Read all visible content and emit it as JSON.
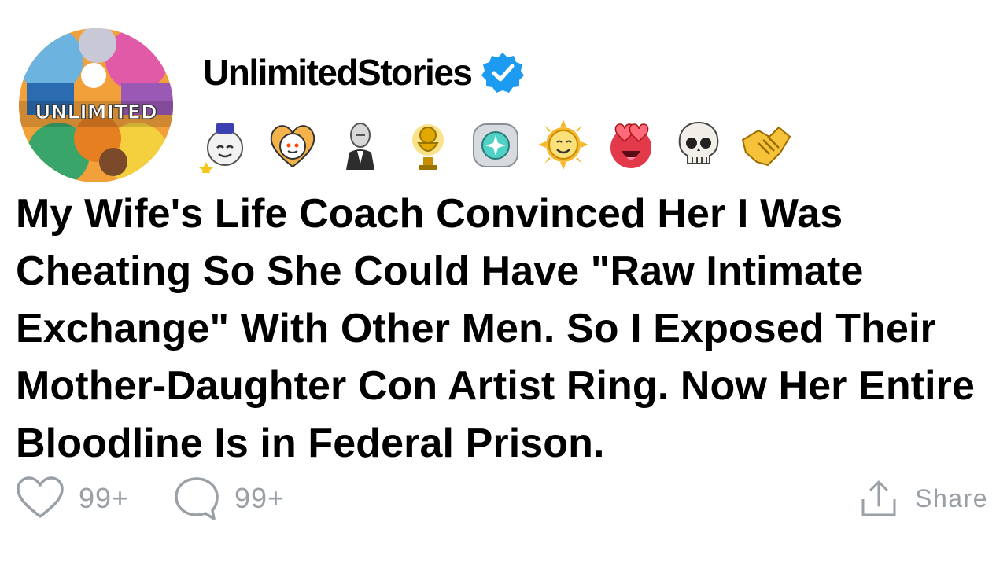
{
  "author": {
    "name": "UnlimitedStories",
    "avatar_text": "UNLIMITED",
    "verified_icon": "verified-check-icon"
  },
  "awards": [
    {
      "icon": "wholesome-award-icon"
    },
    {
      "icon": "heart-eyes-award-icon"
    },
    {
      "icon": "meme-guy-award-icon"
    },
    {
      "icon": "gold-trophy-award-icon"
    },
    {
      "icon": "platinum-gem-award-icon"
    },
    {
      "icon": "sun-smile-award-icon"
    },
    {
      "icon": "love-face-award-icon"
    },
    {
      "icon": "skull-award-icon"
    },
    {
      "icon": "handshake-award-icon"
    }
  ],
  "post": {
    "title": "My Wife's Life Coach Convinced Her I Was Cheating So She Could Have \"Raw Intimate Exchange\" With Other Men. So I Exposed Their Mother-Daughter Con Artist Ring. Now Her Entire Bloodline Is in Federal Prison."
  },
  "actions": {
    "likes": "99+",
    "comments": "99+",
    "share_label": "Share"
  },
  "colors": {
    "verified_blue": "#1d9bf0",
    "action_gray": "#9aa0a6"
  }
}
